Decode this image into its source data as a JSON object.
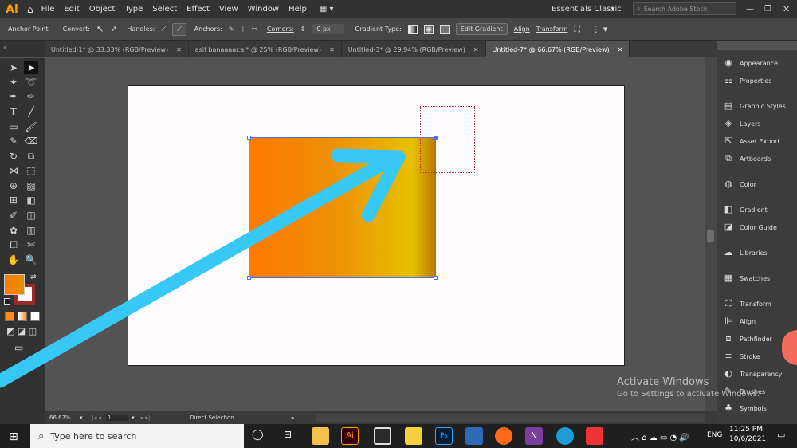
{
  "app": {
    "logo": "Ai",
    "workspace": "Essentials Classic",
    "search_placeholder": "Search Adobe Stock"
  },
  "menu": [
    "File",
    "Edit",
    "Object",
    "Type",
    "Select",
    "Effect",
    "View",
    "Window",
    "Help"
  ],
  "control_bar": {
    "anchor_point": "Anchor Point",
    "convert": "Convert:",
    "handles": "Handles:",
    "anchors": "Anchors:",
    "corners": "Corners:",
    "corners_value": "0 px",
    "gradient_type": "Gradient Type:",
    "edit_gradient": "Edit Gradient",
    "align": "Align",
    "transform": "Transform"
  },
  "tabs": [
    {
      "label": "Untitled-1* @ 33.33% (RGB/Preview)",
      "active": false
    },
    {
      "label": "asif banaaaar.ai* @ 25% (RGB/Preview)",
      "active": false
    },
    {
      "label": "Untitled-3* @ 29.94% (RGB/Preview)",
      "active": false
    },
    {
      "label": "Untitled-7* @ 66.67% (RGB/Preview)",
      "active": true
    }
  ],
  "panels": [
    {
      "label": "Appearance",
      "icon": "appearance-icon"
    },
    {
      "label": "Properties",
      "icon": "properties-icon"
    },
    {
      "label": "Graphic Styles",
      "icon": "graphic-styles-icon"
    },
    {
      "label": "Layers",
      "icon": "layers-icon"
    },
    {
      "label": "Asset Export",
      "icon": "asset-export-icon"
    },
    {
      "label": "Artboards",
      "icon": "artboards-icon"
    },
    {
      "label": "Color",
      "icon": "color-icon"
    },
    {
      "label": "Gradient",
      "icon": "gradient-icon"
    },
    {
      "label": "Color Guide",
      "icon": "color-guide-icon"
    },
    {
      "label": "Libraries",
      "icon": "libraries-icon"
    },
    {
      "label": "Swatches",
      "icon": "swatches-icon"
    },
    {
      "label": "Transform",
      "icon": "transform-icon"
    },
    {
      "label": "Align",
      "icon": "align-icon"
    },
    {
      "label": "Pathfinder",
      "icon": "pathfinder-icon"
    },
    {
      "label": "Stroke",
      "icon": "stroke-icon"
    },
    {
      "label": "Transparency",
      "icon": "transparency-icon"
    },
    {
      "label": "Brushes",
      "icon": "brushes-icon"
    },
    {
      "label": "Symbols",
      "icon": "symbols-icon"
    }
  ],
  "status": {
    "zoom": "66.67%",
    "page": "1",
    "tool": "Direct Selection"
  },
  "watermark": {
    "title": "Activate Windows",
    "subtitle": "Go to Settings to activate Windows."
  },
  "taskbar": {
    "search": "Type here to search",
    "time": "11:25 PM",
    "date": "10/6/2021",
    "lang": "ENG"
  },
  "colors": {
    "gradient_start": "#ff7a00",
    "gradient_mid": "#e6c000",
    "gradient_end": "#b87a00",
    "arrow": "#38c8f5",
    "accent": "#ff9a00"
  }
}
